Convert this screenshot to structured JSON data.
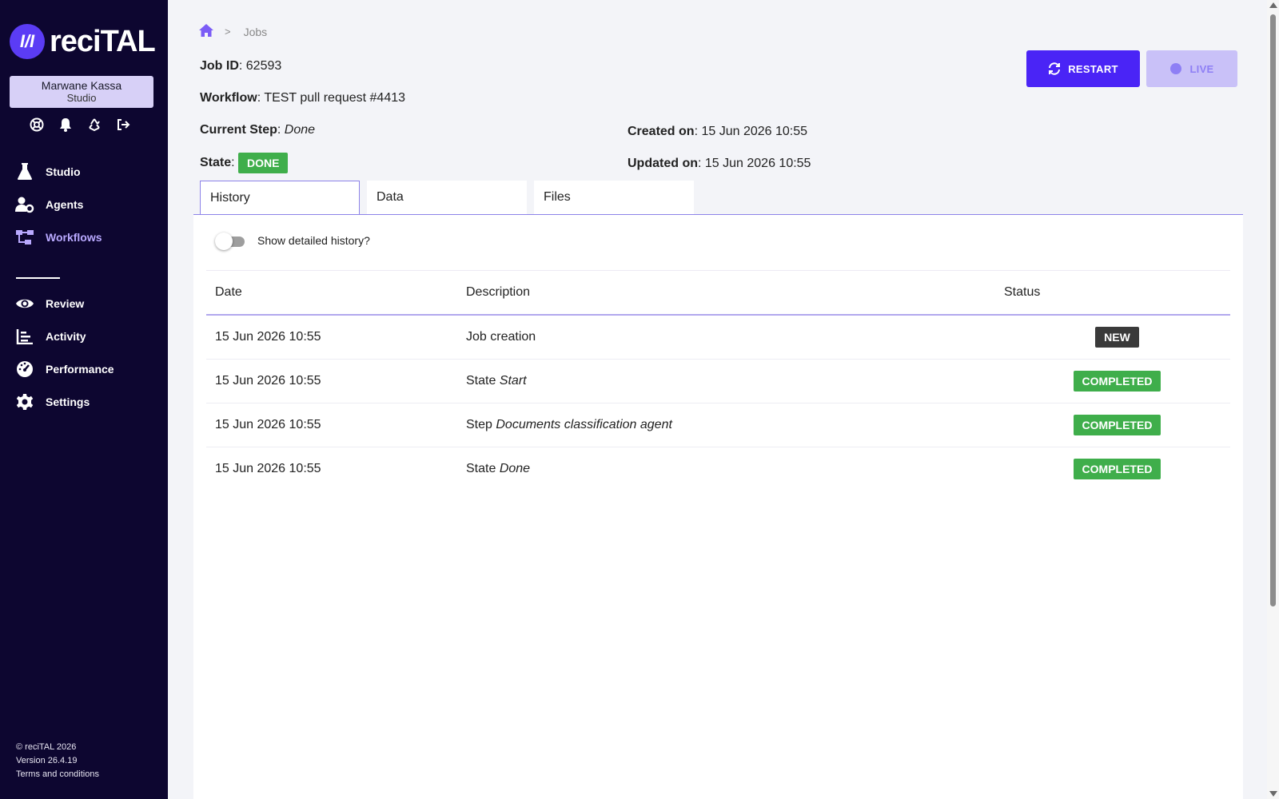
{
  "app": {
    "logo_text": "reciTAL",
    "logo_mark": "I/I"
  },
  "user": {
    "name": "Marwane Kassa",
    "role": "Studio"
  },
  "user_icons": [
    "help-icon",
    "bell-icon",
    "recycle-icon",
    "logout-icon"
  ],
  "nav_primary": [
    {
      "label": "Studio",
      "icon": "flask-icon",
      "active": false
    },
    {
      "label": "Agents",
      "icon": "agents-icon",
      "active": false
    },
    {
      "label": "Workflows",
      "icon": "workflow-icon",
      "active": true
    }
  ],
  "nav_secondary": [
    {
      "label": "Review",
      "icon": "eye-icon"
    },
    {
      "label": "Activity",
      "icon": "chart-icon"
    },
    {
      "label": "Performance",
      "icon": "gauge-icon"
    },
    {
      "label": "Settings",
      "icon": "gear-icon"
    }
  ],
  "footer": {
    "copyright": "© reciTAL 2026",
    "version": "Version 26.4.19",
    "terms": "Terms and conditions"
  },
  "breadcrumb": {
    "home_icon": "home-icon",
    "current": "Jobs"
  },
  "job": {
    "id_label": "Job ID",
    "id": "62593",
    "workflow_label": "Workflow",
    "workflow": "TEST pull request #4413",
    "step_label": "Current Step",
    "step": "Done",
    "state_label": "State",
    "state": "DONE",
    "created_label": "Created on",
    "created": "15 Jun 2026 10:55",
    "updated_label": "Updated on",
    "updated": "15 Jun 2026 10:55"
  },
  "actions": {
    "restart": "RESTART",
    "live": "LIVE"
  },
  "tabs": [
    {
      "label": "History",
      "active": true
    },
    {
      "label": "Data"
    },
    {
      "label": "Files"
    }
  ],
  "history": {
    "toggle_label": "Show detailed history?",
    "toggle_on": false,
    "columns": [
      "Date",
      "Description",
      "Status"
    ],
    "rows": [
      {
        "date": "15 Jun 2026 10:55",
        "desc_prefix": "Job creation",
        "desc_em": "",
        "status": "NEW"
      },
      {
        "date": "15 Jun 2026 10:55",
        "desc_prefix": "State ",
        "desc_em": "Start",
        "status": "COMPLETED"
      },
      {
        "date": "15 Jun 2026 10:55",
        "desc_prefix": "Step ",
        "desc_em": "Documents classification agent",
        "status": "COMPLETED"
      },
      {
        "date": "15 Jun 2026 10:55",
        "desc_prefix": "State ",
        "desc_em": "Done",
        "status": "COMPLETED"
      }
    ]
  },
  "colors": {
    "sidebar": "#0d0630",
    "accent": "#4a24f6",
    "success": "#3fae4b",
    "neutral_badge": "#3a3a3a"
  }
}
